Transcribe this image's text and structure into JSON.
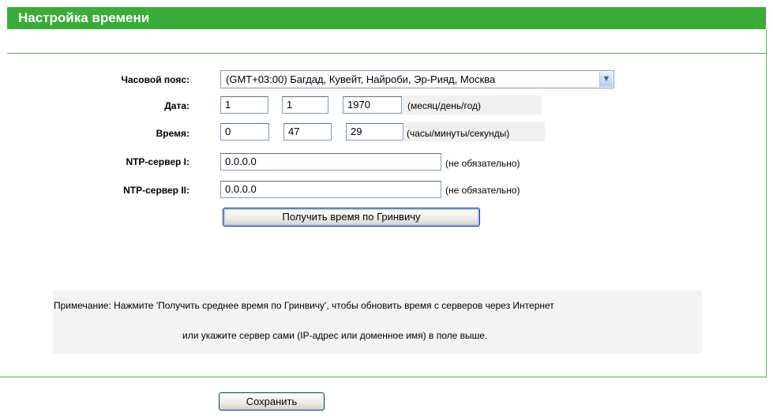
{
  "page": {
    "title": "Настройка времени"
  },
  "form": {
    "timezone": {
      "label": "Часовой пояс:",
      "value": "(GMT+03:00) Багдад, Кувейт, Найроби, Эр-Рияд, Москва"
    },
    "date": {
      "label": "Дата:",
      "month": "1",
      "day": "1",
      "year": "1970",
      "hint": "(месяц/день/год)"
    },
    "time": {
      "label": "Время:",
      "hours": "0",
      "minutes": "47",
      "seconds": "29",
      "hint": "(часы/минуты/секунды)"
    },
    "ntp1": {
      "label": "NTP-сервер I:",
      "value": "0.0.0.0",
      "hint": "(не обязательно)"
    },
    "ntp2": {
      "label": "NTP-сервер II:",
      "value": "0.0.0.0",
      "hint": "(не обязательно)"
    },
    "get_gmt_button": "Получить время по Гринвичу"
  },
  "remark": {
    "line1": "Примечание: Нажмите 'Получить среднее время по Гринвичу', чтобы обновить время с серверов через Интернет",
    "line2": "или укажите сервер сами (IP-адрес или доменное имя) в поле выше."
  },
  "footer": {
    "save_button": "Сохранить"
  },
  "colors": {
    "title_bar": "#3aac3a",
    "separator": "#5ea25e"
  },
  "icons": {
    "select_arrow": "chevron-down-icon"
  }
}
